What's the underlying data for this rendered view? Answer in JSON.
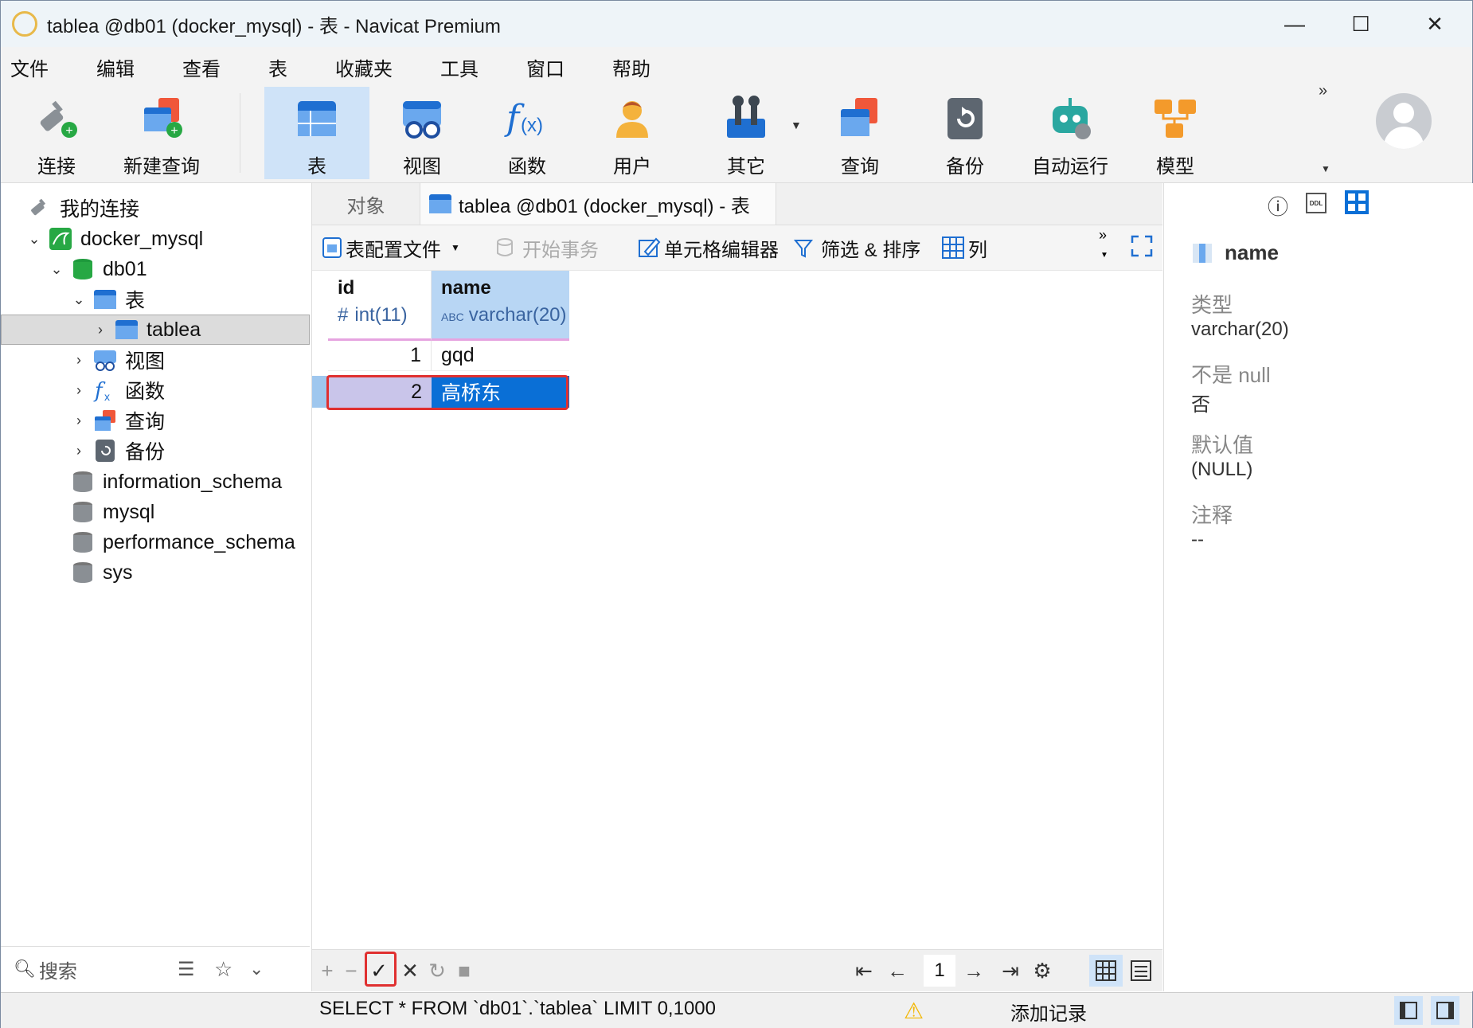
{
  "window": {
    "title": "tablea @db01 (docker_mysql) - 表 - Navicat Premium",
    "controls": [
      "—",
      "☐",
      "✕"
    ]
  },
  "menu": [
    "文件",
    "编辑",
    "查看",
    "表",
    "收藏夹",
    "工具",
    "窗口",
    "帮助"
  ],
  "toolbar": {
    "connect": "连接",
    "new_query": "新建查询",
    "table": "表",
    "view": "视图",
    "function": "函数",
    "user": "用户",
    "other": "其它",
    "query": "查询",
    "backup": "备份",
    "automation": "自动运行",
    "model": "模型",
    "more": "»"
  },
  "navigator": {
    "root": "我的连接",
    "connection": "docker_mysql",
    "database": "db01",
    "tables_group": "表",
    "table": "tablea",
    "views_group": "视图",
    "functions_group": "函数",
    "queries_group": "查询",
    "backups_group": "备份",
    "other_dbs": [
      "information_schema",
      "mysql",
      "performance_schema",
      "sys"
    ],
    "search_placeholder": "搜索"
  },
  "tabs": {
    "objects": "对象",
    "active": "tablea @db01 (docker_mysql) - 表"
  },
  "subtoolbar": {
    "profile": "表配置文件",
    "begin_tx": "开始事务",
    "cell_editor": "单元格编辑器",
    "filter_sort": "筛选 & 排序",
    "columns": "列"
  },
  "grid": {
    "columns": [
      {
        "name": "id",
        "type": "int(11)",
        "type_icon": "#"
      },
      {
        "name": "name",
        "type": "varchar(20)",
        "type_icon": "ABC"
      }
    ],
    "rows": [
      {
        "id": "1",
        "name": "gqd"
      },
      {
        "id": "2",
        "name": "高桥东"
      }
    ]
  },
  "pager": {
    "page": "1"
  },
  "field_info": {
    "field": "name",
    "type_label": "类型",
    "type_value": "varchar(20)",
    "notnull_label": "不是 null",
    "notnull_value": "否",
    "default_label": "默认值",
    "default_value": "(NULL)",
    "comment_label": "注释",
    "comment_value": "--"
  },
  "status": {
    "sql": "SELECT * FROM `db01`.`tablea` LIMIT 0,1000",
    "message": "添加记录"
  },
  "colors": {
    "accent": "#0a6fd6",
    "selected_cell": "#0a6fd6",
    "highlight_box": "#e03030"
  }
}
